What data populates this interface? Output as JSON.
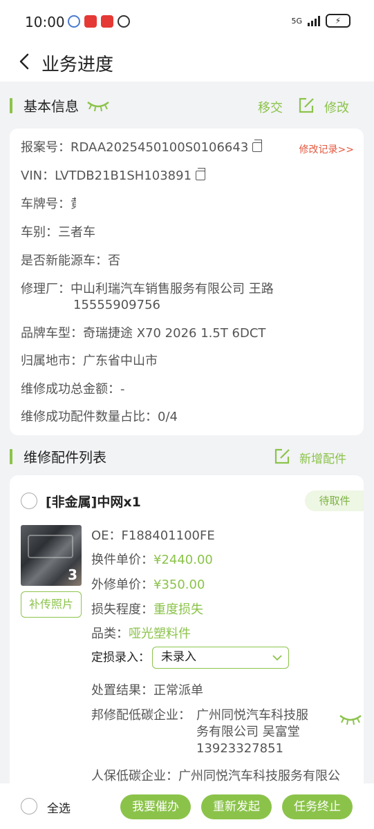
{
  "status_bar": {
    "time": "10:00",
    "network": "5G",
    "battery_icon": "battery-charging-icon",
    "left_icons": [
      "notification-icon",
      "app-icon-red-1",
      "app-icon-red-2",
      "shield-icon"
    ]
  },
  "nav": {
    "title": "业务进度",
    "back_icon": "chevron-left-icon"
  },
  "basic_info": {
    "section_title": "基本信息",
    "toggle_icon": "eye-closed-icon",
    "transfer_label": "移交",
    "edit_label": "修改",
    "history_link": "修改记录>>",
    "report_no": "报案号：RDAA2025450100S0106643",
    "vin": "VIN：LVTDB21B1SH103891",
    "plate": "车牌号：",
    "plate_value": "黄",
    "vehicle_type": "车别：三者车",
    "new_energy": "是否新能源车：否",
    "repair_shop_line1": "修理厂：中山利瑞汽车销售服务有限公司 王路",
    "repair_shop_line2": "15555909756",
    "brand_model": "品牌车型：奇瑞捷途 X70 2026 1.5T 6DCT",
    "region": "归属地市：广东省中山市",
    "total_amount": "维修成功总金额：-",
    "parts_ratio": "维修成功配件数量占比：0/4"
  },
  "parts_list": {
    "section_title": "维修配件列表",
    "add_label": "新增配件",
    "item": {
      "title": "[非金属]中网x1",
      "status": "待取件",
      "photo_count": "3",
      "upload_label": "补传照片",
      "oe_label": "OE：",
      "oe_value": "F188401100FE",
      "replace_price_label": "换件单价：",
      "replace_price": "¥2440.00",
      "outside_price_label": "外修单价：",
      "outside_price": "¥350.00",
      "damage_label": "损失程度：",
      "damage_value": "重度损失",
      "category_label": "品类：",
      "category_value": "哑光塑料件",
      "assess_label": "定损录入：",
      "assess_value": "未录入",
      "result": "处置结果：正常派单",
      "lowcarbon_label": "邦修配低碳企业：",
      "lowcarbon_line1": "广州同悦汽车科技服",
      "lowcarbon_line2": "务有限公司 吴富堂",
      "lowcarbon_line3": "13923327851",
      "picc_label": "人保低碳企业：",
      "picc_value": "广州同悦汽车科技服务有限公"
    }
  },
  "bottom": {
    "select_all": "全选",
    "urge_label": "我要催办",
    "resend_label": "重新发起",
    "terminate_label": "任务终止"
  },
  "colors": {
    "accent": "#8bc34a",
    "link_red": "#e4573d",
    "background": "#f2f3f5"
  }
}
